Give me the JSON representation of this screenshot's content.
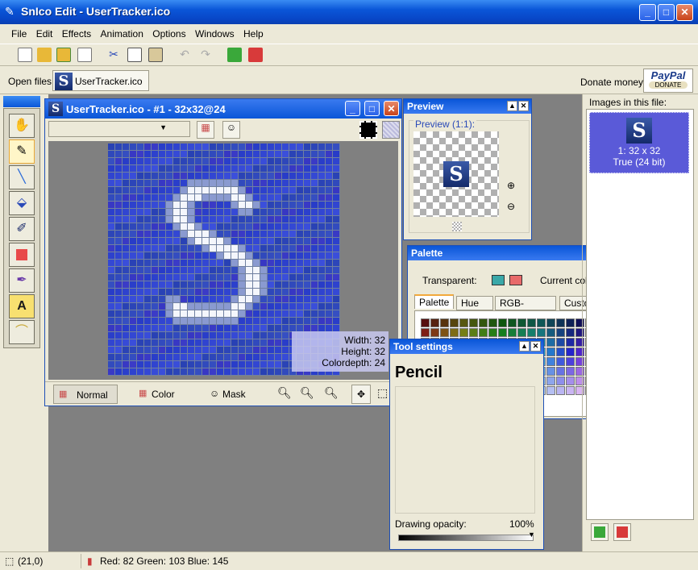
{
  "app": {
    "title": "SnIco Edit - UserTracker.ico"
  },
  "menu": [
    "File",
    "Edit",
    "Effects",
    "Animation",
    "Options",
    "Windows",
    "Help"
  ],
  "open_files": {
    "label": "Open files:",
    "file": "UserTracker.ico",
    "donate_label": "Donate money:",
    "paypal": "PayPal",
    "donate": "DONATE"
  },
  "editor": {
    "title": "UserTracker.ico - #1 - 32x32@24",
    "modes": [
      "Normal",
      "Color",
      "Mask"
    ],
    "info": {
      "width": "Width: 32",
      "height": "Height: 32",
      "depth": "Colordepth: 24"
    }
  },
  "preview": {
    "title": "Preview",
    "label": "Preview (1:1):"
  },
  "palette": {
    "title": "Palette",
    "transparent_label": "Transparent:",
    "current_label": "Current colors:",
    "tabs": [
      "Palette",
      "Hue",
      "RGB-values",
      "Custom colors"
    ]
  },
  "tool_settings": {
    "title": "Tool settings",
    "tool_name": "Pencil",
    "opacity_label": "Drawing opacity:",
    "opacity_value": "100%",
    "opacity": 1.0
  },
  "images": {
    "header": "Images in this file:",
    "item_size": "1: 32 x 32",
    "item_depth": "True (24 bit)"
  },
  "status": {
    "coords": "(21,0)",
    "color": "Red: 82 Green: 103 Blue: 145"
  },
  "colors": {
    "accent": "#0a56d8",
    "selection": "#5a5ad8",
    "icon_blue": "#3a4f8f"
  }
}
